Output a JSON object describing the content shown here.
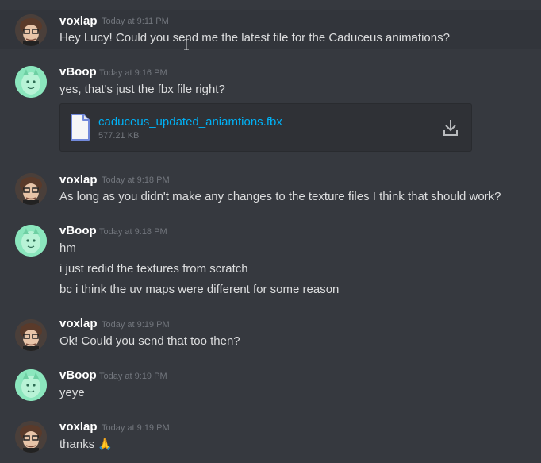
{
  "messages": [
    {
      "author": "voxlap",
      "time": "Today at 9:11 PM",
      "lines": [
        "Hey Lucy! Could you send me the latest file for the Caduceus animations?"
      ]
    },
    {
      "author": "vBoop",
      "time": "Today at 9:16 PM",
      "lines": [
        "yes, that's just the fbx file right?"
      ],
      "attachment": {
        "name": "caduceus_updated_aniamtions.fbx",
        "size": "577.21 KB"
      }
    },
    {
      "author": "voxlap",
      "time": "Today at 9:18 PM",
      "lines": [
        "As long as you didn't make any changes to the texture files I think that should work?"
      ]
    },
    {
      "author": "vBoop",
      "time": "Today at 9:18 PM",
      "lines": [
        "hm",
        "i just redid the textures from scratch",
        "bc i think the uv maps were different for some reason"
      ]
    },
    {
      "author": "voxlap",
      "time": "Today at 9:19 PM",
      "lines": [
        "Ok! Could you send that too then?"
      ]
    },
    {
      "author": "vBoop",
      "time": "Today at 9:19 PM",
      "lines": [
        "yeye"
      ]
    },
    {
      "author": "voxlap",
      "time": "Today at 9:19 PM",
      "lines": [
        "thanks 🙏"
      ]
    }
  ],
  "icons": {
    "avatar_voxlap": "avatar-voxlap",
    "avatar_vboop": "avatar-vboop",
    "file": "file-icon",
    "download": "download-icon"
  },
  "colors": {
    "background": "#36393f",
    "link": "#00b0f4",
    "username": "#ffffff"
  }
}
